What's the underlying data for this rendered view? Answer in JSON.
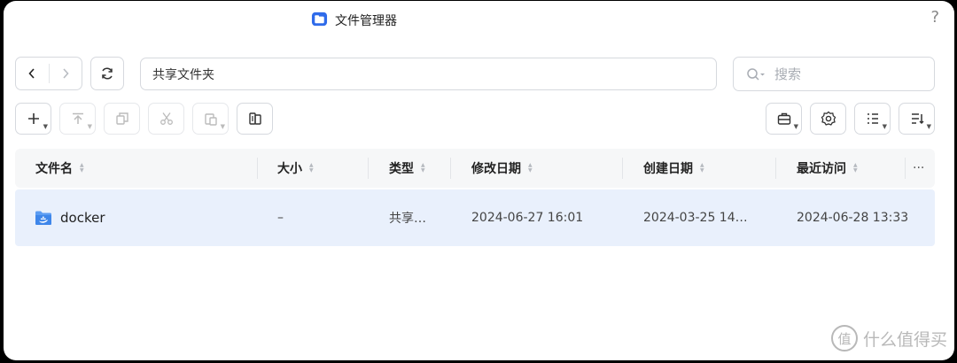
{
  "window": {
    "title": "文件管理器",
    "help": "?"
  },
  "toolbar": {
    "path": "共享文件夹",
    "search_placeholder": "搜索"
  },
  "table": {
    "headers": [
      "文件名",
      "大小",
      "类型",
      "修改日期",
      "创建日期",
      "最近访问"
    ],
    "rows": [
      {
        "name": "docker",
        "size": "–",
        "type": "共享…",
        "modified": "2024-06-27 16:01",
        "created": "2024-03-25 14…",
        "accessed": "2024-06-28 13:33"
      }
    ],
    "more": "···"
  },
  "watermark": {
    "logo": "值",
    "text": "什么值得买"
  },
  "colors": {
    "accent": "#2f6bea",
    "row_selected": "#e9f0fc",
    "header_bg": "#f6f7f8"
  }
}
